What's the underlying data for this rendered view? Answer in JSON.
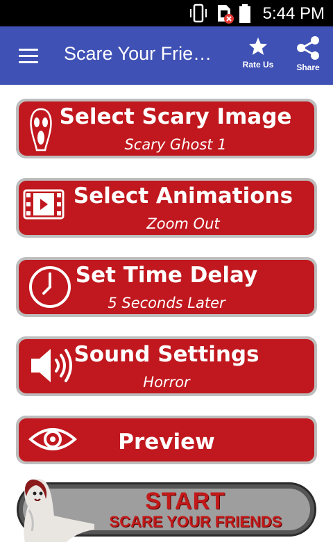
{
  "status_bar": {
    "time": "5:44 PM"
  },
  "app_bar": {
    "title": "Scare Your Frie…",
    "rate_label": "Rate Us",
    "share_label": "Share"
  },
  "buttons": [
    {
      "title": "Select Scary Image",
      "subtitle": "Scary Ghost 1",
      "icon": "ghost-mask-icon"
    },
    {
      "title": "Select Animations",
      "subtitle": "Zoom Out",
      "icon": "video-icon"
    },
    {
      "title": "Set Time Delay",
      "subtitle": "5 Seconds Later",
      "icon": "clock-icon"
    },
    {
      "title": "Sound Settings",
      "subtitle": "Horror",
      "icon": "speaker-icon"
    },
    {
      "title": "Preview",
      "icon": "eye-icon"
    }
  ],
  "start_banner": {
    "line1": "START",
    "line2": "SCARE YOUR FRIENDS"
  },
  "colors": {
    "app_bar": "#3f51b5",
    "button_red": "#c0181e",
    "button_border": "#bdbdbd"
  }
}
